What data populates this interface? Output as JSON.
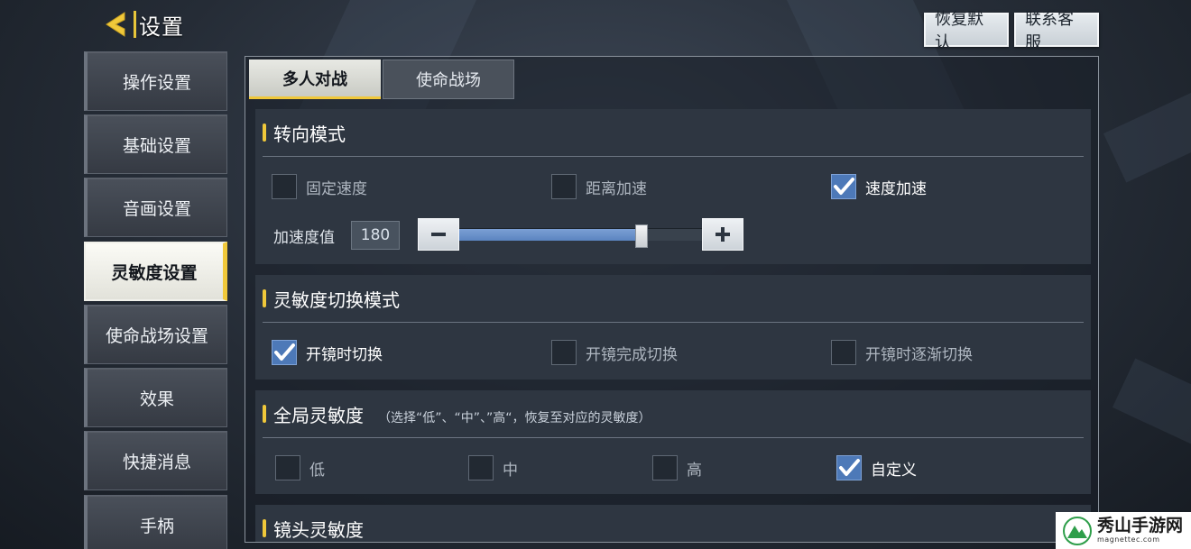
{
  "header": {
    "title": "设置"
  },
  "top_buttons": {
    "restore": "恢复默认",
    "service": "联系客服"
  },
  "sidebar": {
    "items": [
      {
        "label": "操作设置"
      },
      {
        "label": "基础设置"
      },
      {
        "label": "音画设置"
      },
      {
        "label": "灵敏度设置",
        "active": true
      },
      {
        "label": "使命战场设置"
      },
      {
        "label": "效果"
      },
      {
        "label": "快捷消息"
      },
      {
        "label": "手柄"
      }
    ]
  },
  "tabs": [
    {
      "label": "多人对战",
      "active": true
    },
    {
      "label": "使命战场"
    }
  ],
  "turn_mode": {
    "title": "转向模式",
    "options": [
      {
        "label": "固定速度",
        "checked": false
      },
      {
        "label": "距离加速",
        "checked": false
      },
      {
        "label": "速度加速",
        "checked": true
      }
    ],
    "accel": {
      "label": "加速度值",
      "value": "180",
      "fill": 0.75
    }
  },
  "switch_mode": {
    "title": "灵敏度切换模式",
    "options": [
      {
        "label": "开镜时切换",
        "checked": true
      },
      {
        "label": "开镜完成切换",
        "checked": false
      },
      {
        "label": "开镜时逐渐切换",
        "checked": false
      }
    ]
  },
  "global_sens": {
    "title": "全局灵敏度",
    "hint": "（选择“低”、“中”、”高“，恢复至对应的灵敏度）",
    "options": [
      {
        "label": "低",
        "checked": false
      },
      {
        "label": "中",
        "checked": false
      },
      {
        "label": "高",
        "checked": false
      },
      {
        "label": "自定义",
        "checked": true
      }
    ]
  },
  "lens_sens": {
    "title": "镜头灵敏度"
  },
  "watermark": {
    "name": "秀山手游网",
    "domain": "magnettec.com"
  },
  "colors": {
    "accent": "#f0c83a",
    "check": "#4d79b8",
    "panel": "#2e3641"
  }
}
